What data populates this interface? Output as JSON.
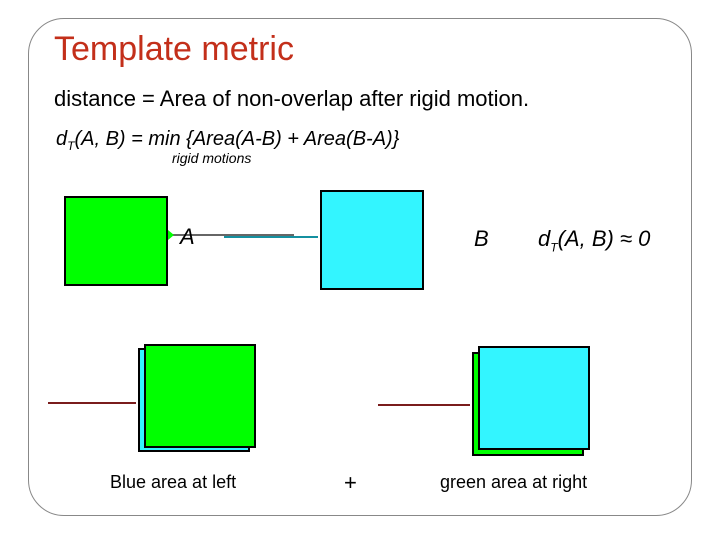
{
  "title": "Template metric",
  "subtitle": "distance = Area of non-overlap after rigid motion.",
  "formula_prefix": "d",
  "formula_sub": "T",
  "formula_rest": "(A, B) = min  {Area(A-B) + Area(B-A)}",
  "formula_subscript": "rigid motions",
  "labels": {
    "A": "A",
    "B": "B",
    "dT": "(A, B) ≈ 0",
    "dT_prefix": "d",
    "dT_sub": "T"
  },
  "captions": {
    "blue_left": "Blue area at left",
    "plus": "+",
    "green_right": "green area at right"
  },
  "colors": {
    "green": "#00ff00",
    "cyan": "#33f5ff",
    "title": "#c32f1a"
  }
}
